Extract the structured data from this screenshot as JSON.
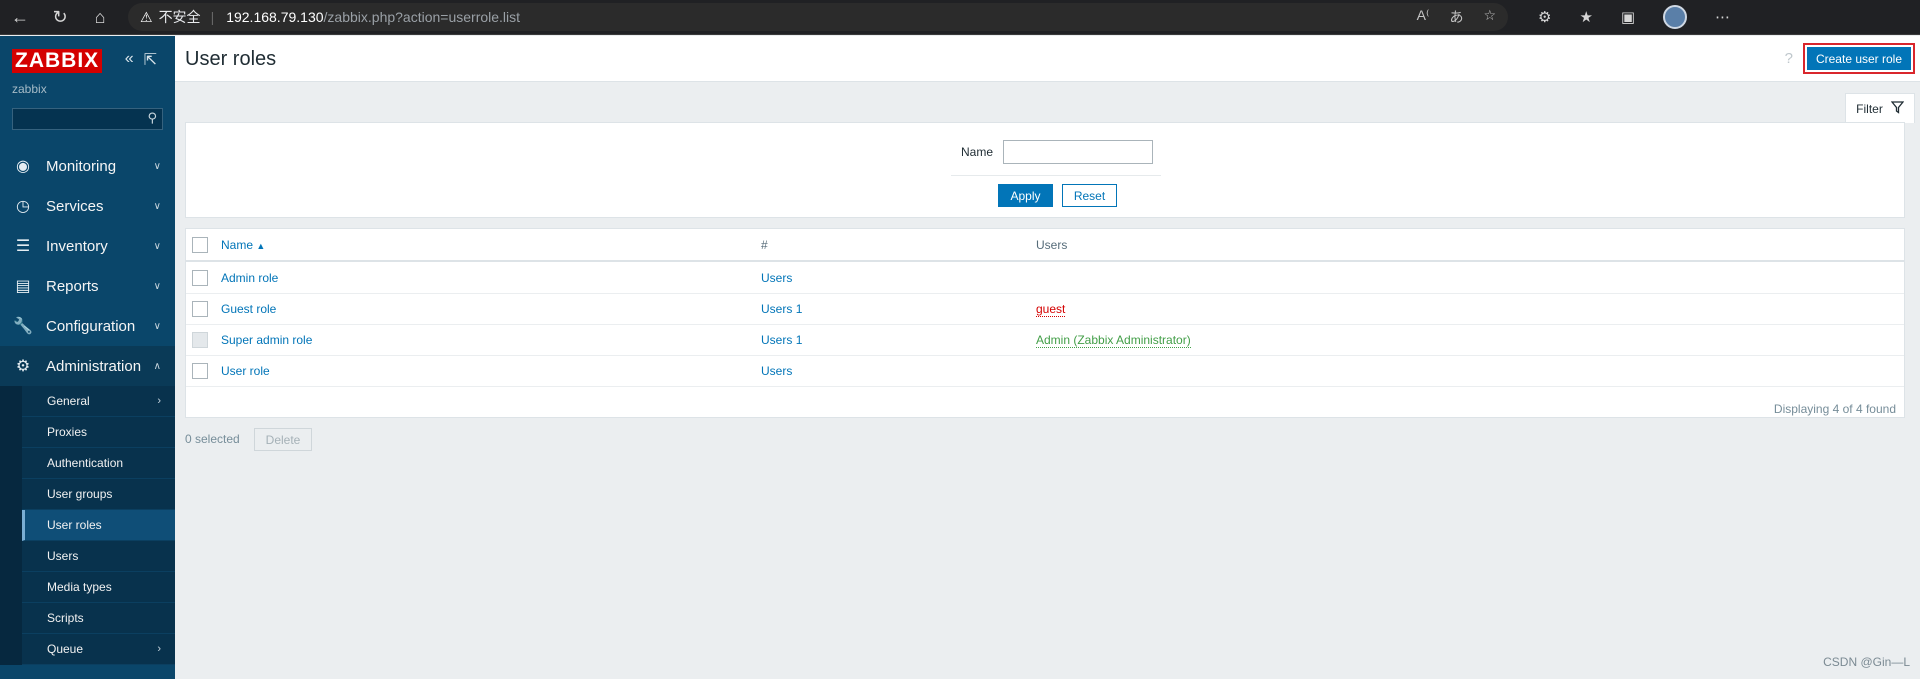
{
  "browser": {
    "insecure_label": "不安全",
    "url_host": "192.168.79.130",
    "url_path": "/zabbix.php?action=userrole.list"
  },
  "sidebar": {
    "logo": "ZABBIX",
    "server_name": "zabbix",
    "search_value": "",
    "menu": [
      {
        "label": "Monitoring",
        "icon": "eye-icon"
      },
      {
        "label": "Services",
        "icon": "clock-icon"
      },
      {
        "label": "Inventory",
        "icon": "list-icon"
      },
      {
        "label": "Reports",
        "icon": "chart-icon"
      },
      {
        "label": "Configuration",
        "icon": "wrench-icon"
      },
      {
        "label": "Administration",
        "icon": "gear-icon"
      }
    ],
    "submenu": [
      "General",
      "Proxies",
      "Authentication",
      "User groups",
      "User roles",
      "Users",
      "Media types",
      "Scripts",
      "Queue"
    ]
  },
  "header": {
    "title": "User roles",
    "create_button": "Create user role"
  },
  "filter": {
    "tab_label": "Filter",
    "name_label": "Name",
    "name_value": "",
    "apply_label": "Apply",
    "reset_label": "Reset"
  },
  "table": {
    "headers": {
      "name": "Name",
      "count": "#",
      "users": "Users"
    },
    "rows": [
      {
        "name": "Admin role",
        "users_link": "Users",
        "users_count": "",
        "user_list": ""
      },
      {
        "name": "Guest role",
        "users_link": "Users",
        "users_count": "1",
        "user_list": "guest"
      },
      {
        "name": "Super admin role",
        "users_link": "Users",
        "users_count": "1",
        "user_list": "Admin (Zabbix Administrator)"
      },
      {
        "name": "User role",
        "users_link": "Users",
        "users_count": "",
        "user_list": ""
      }
    ],
    "footer": "Displaying 4 of 4 found"
  },
  "actions": {
    "selected": "0 selected",
    "delete_label": "Delete"
  },
  "watermark": "CSDN @Gin—L",
  "colors": {
    "sidebar": "#0a466a",
    "accent": "#0275b8",
    "logo_red": "#d40000",
    "user_red": "#d40000",
    "user_green": "#429e47"
  }
}
